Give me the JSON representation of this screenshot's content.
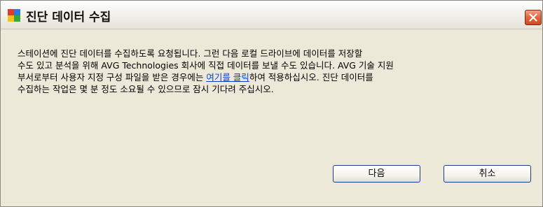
{
  "window": {
    "title": "진단 데이터 수집",
    "icon": "avg-app-icon",
    "close_icon": "close-icon"
  },
  "message": {
    "line1": "스테이션에 진단 데이터를 수집하도록 요청됩니다. 그런 다음 로컬 드라이브에 데이터를 저장할",
    "line2": "수도 있고 분석을 위해 AVG Technologies 회사에 직접 데이터를 보낼 수도 있습니다. AVG 기술 지원",
    "line3_before": "부서로부터 사용자 지정 구성 파일을 받은 경우에는 ",
    "link_text": "여기를 클릭",
    "line3_after": "하여 적용하십시오. 진단 데이터를",
    "line4": "수집하는 작업은 몇 분 정도 소요될 수 있으므로 잠시 기다려 주십시오."
  },
  "buttons": {
    "next_label": "다음",
    "cancel_label": "취소"
  },
  "colors": {
    "dialog_background": "#ece9d8",
    "link": "#0b3fd1",
    "button_border": "#1f3c8a",
    "close_button": "#e2653f"
  }
}
